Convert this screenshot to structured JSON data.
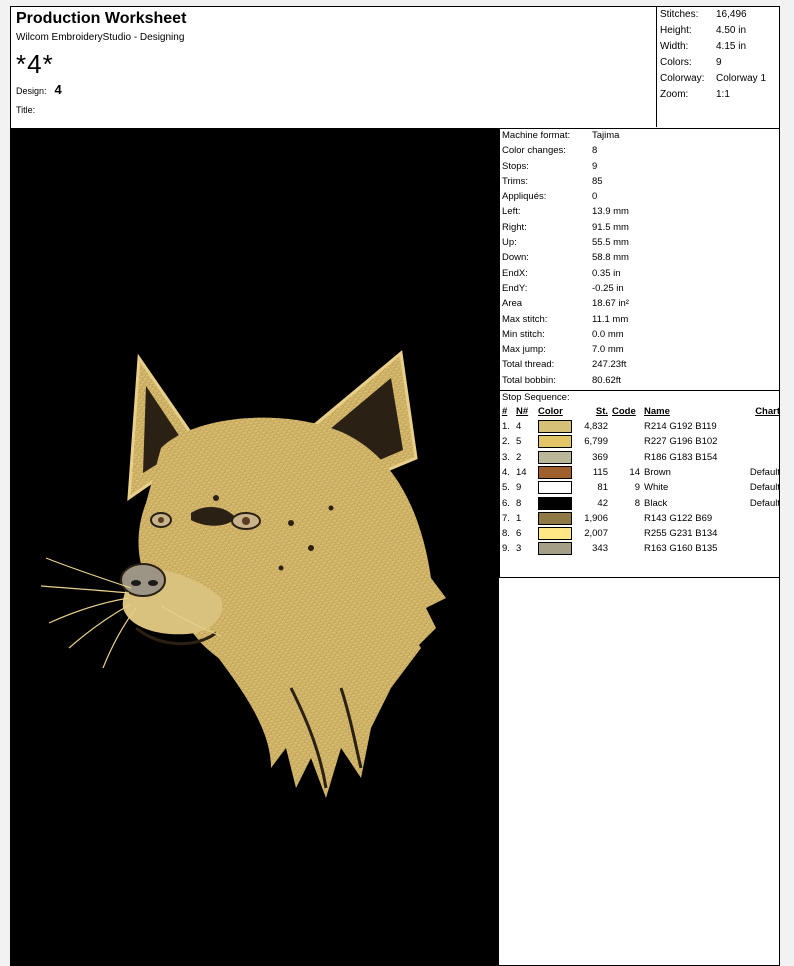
{
  "header": {
    "title": "Production Worksheet",
    "subtitle": "Wilcom EmbroideryStudio - Designing",
    "design_name": "*4*",
    "design_label": "Design:",
    "design_value": "4",
    "title_label": "Title:"
  },
  "summary": [
    {
      "label": "Stitches:",
      "value": "16,496"
    },
    {
      "label": "Height:",
      "value": "4.50 in"
    },
    {
      "label": "Width:",
      "value": "4.15 in"
    },
    {
      "label": "Colors:",
      "value": "9"
    },
    {
      "label": "Colorway:",
      "value": "Colorway 1"
    },
    {
      "label": "Zoom:",
      "value": "1:1"
    }
  ],
  "machine_stats": [
    {
      "label": "Machine format:",
      "value": "Tajima"
    },
    {
      "label": "Color changes:",
      "value": "8"
    },
    {
      "label": "Stops:",
      "value": "9"
    },
    {
      "label": "Trims:",
      "value": "85"
    },
    {
      "label": "Appliqués:",
      "value": "0"
    },
    {
      "label": "Left:",
      "value": "13.9 mm"
    },
    {
      "label": "Right:",
      "value": "91.5 mm"
    },
    {
      "label": "Up:",
      "value": "55.5 mm"
    },
    {
      "label": "Down:",
      "value": "58.8 mm"
    },
    {
      "label": "EndX:",
      "value": "0.35 in"
    },
    {
      "label": "EndY:",
      "value": "-0.25 in"
    },
    {
      "label": "Area",
      "value": "18.67 in²"
    },
    {
      "label": "Max stitch:",
      "value": "11.1 mm"
    },
    {
      "label": "Min stitch:",
      "value": "0.0 mm"
    },
    {
      "label": "Max jump:",
      "value": "7.0 mm"
    },
    {
      "label": "Total thread:",
      "value": "247.23ft"
    },
    {
      "label": "Total bobbin:",
      "value": "80.62ft"
    }
  ],
  "stop_sequence": {
    "title": "Stop Sequence:",
    "headers": {
      "idx": "#",
      "needle": "N#",
      "color": "Color",
      "stitches": "St.",
      "code": "Code",
      "name": "Name",
      "chart": "Chart"
    },
    "rows": [
      {
        "idx": "1.",
        "needle": "4",
        "color": "#d6c077",
        "stitches": "4,832",
        "code": "",
        "name": "R214 G192 B119",
        "chart": ""
      },
      {
        "idx": "2.",
        "needle": "5",
        "color": "#e3c466",
        "stitches": "6,799",
        "code": "",
        "name": "R227 G196 B102",
        "chart": ""
      },
      {
        "idx": "3.",
        "needle": "2",
        "color": "#bab79a",
        "stitches": "369",
        "code": "",
        "name": "R186 G183 B154",
        "chart": ""
      },
      {
        "idx": "4.",
        "needle": "14",
        "color": "#a0602e",
        "stitches": "115",
        "code": "14",
        "name": "Brown",
        "chart": "Default"
      },
      {
        "idx": "5.",
        "needle": "9",
        "color": "#ffffff",
        "stitches": "81",
        "code": "9",
        "name": "White",
        "chart": "Default"
      },
      {
        "idx": "6.",
        "needle": "8",
        "color": "#000000",
        "stitches": "42",
        "code": "8",
        "name": "Black",
        "chart": "Default"
      },
      {
        "idx": "7.",
        "needle": "1",
        "color": "#8f7a45",
        "stitches": "1,906",
        "code": "",
        "name": "R143 G122 B69",
        "chart": ""
      },
      {
        "idx": "8.",
        "needle": "6",
        "color": "#ffe786",
        "stitches": "2,007",
        "code": "",
        "name": "R255 G231 B134",
        "chart": ""
      },
      {
        "idx": "9.",
        "needle": "3",
        "color": "#a3a087",
        "stitches": "343",
        "code": "",
        "name": "R163 G160 B135",
        "chart": ""
      }
    ]
  },
  "colors": {
    "fur_light": "#e8d08a",
    "fur_mid": "#c9ac62",
    "fur_dark": "#7a6232",
    "background": "#000000"
  }
}
